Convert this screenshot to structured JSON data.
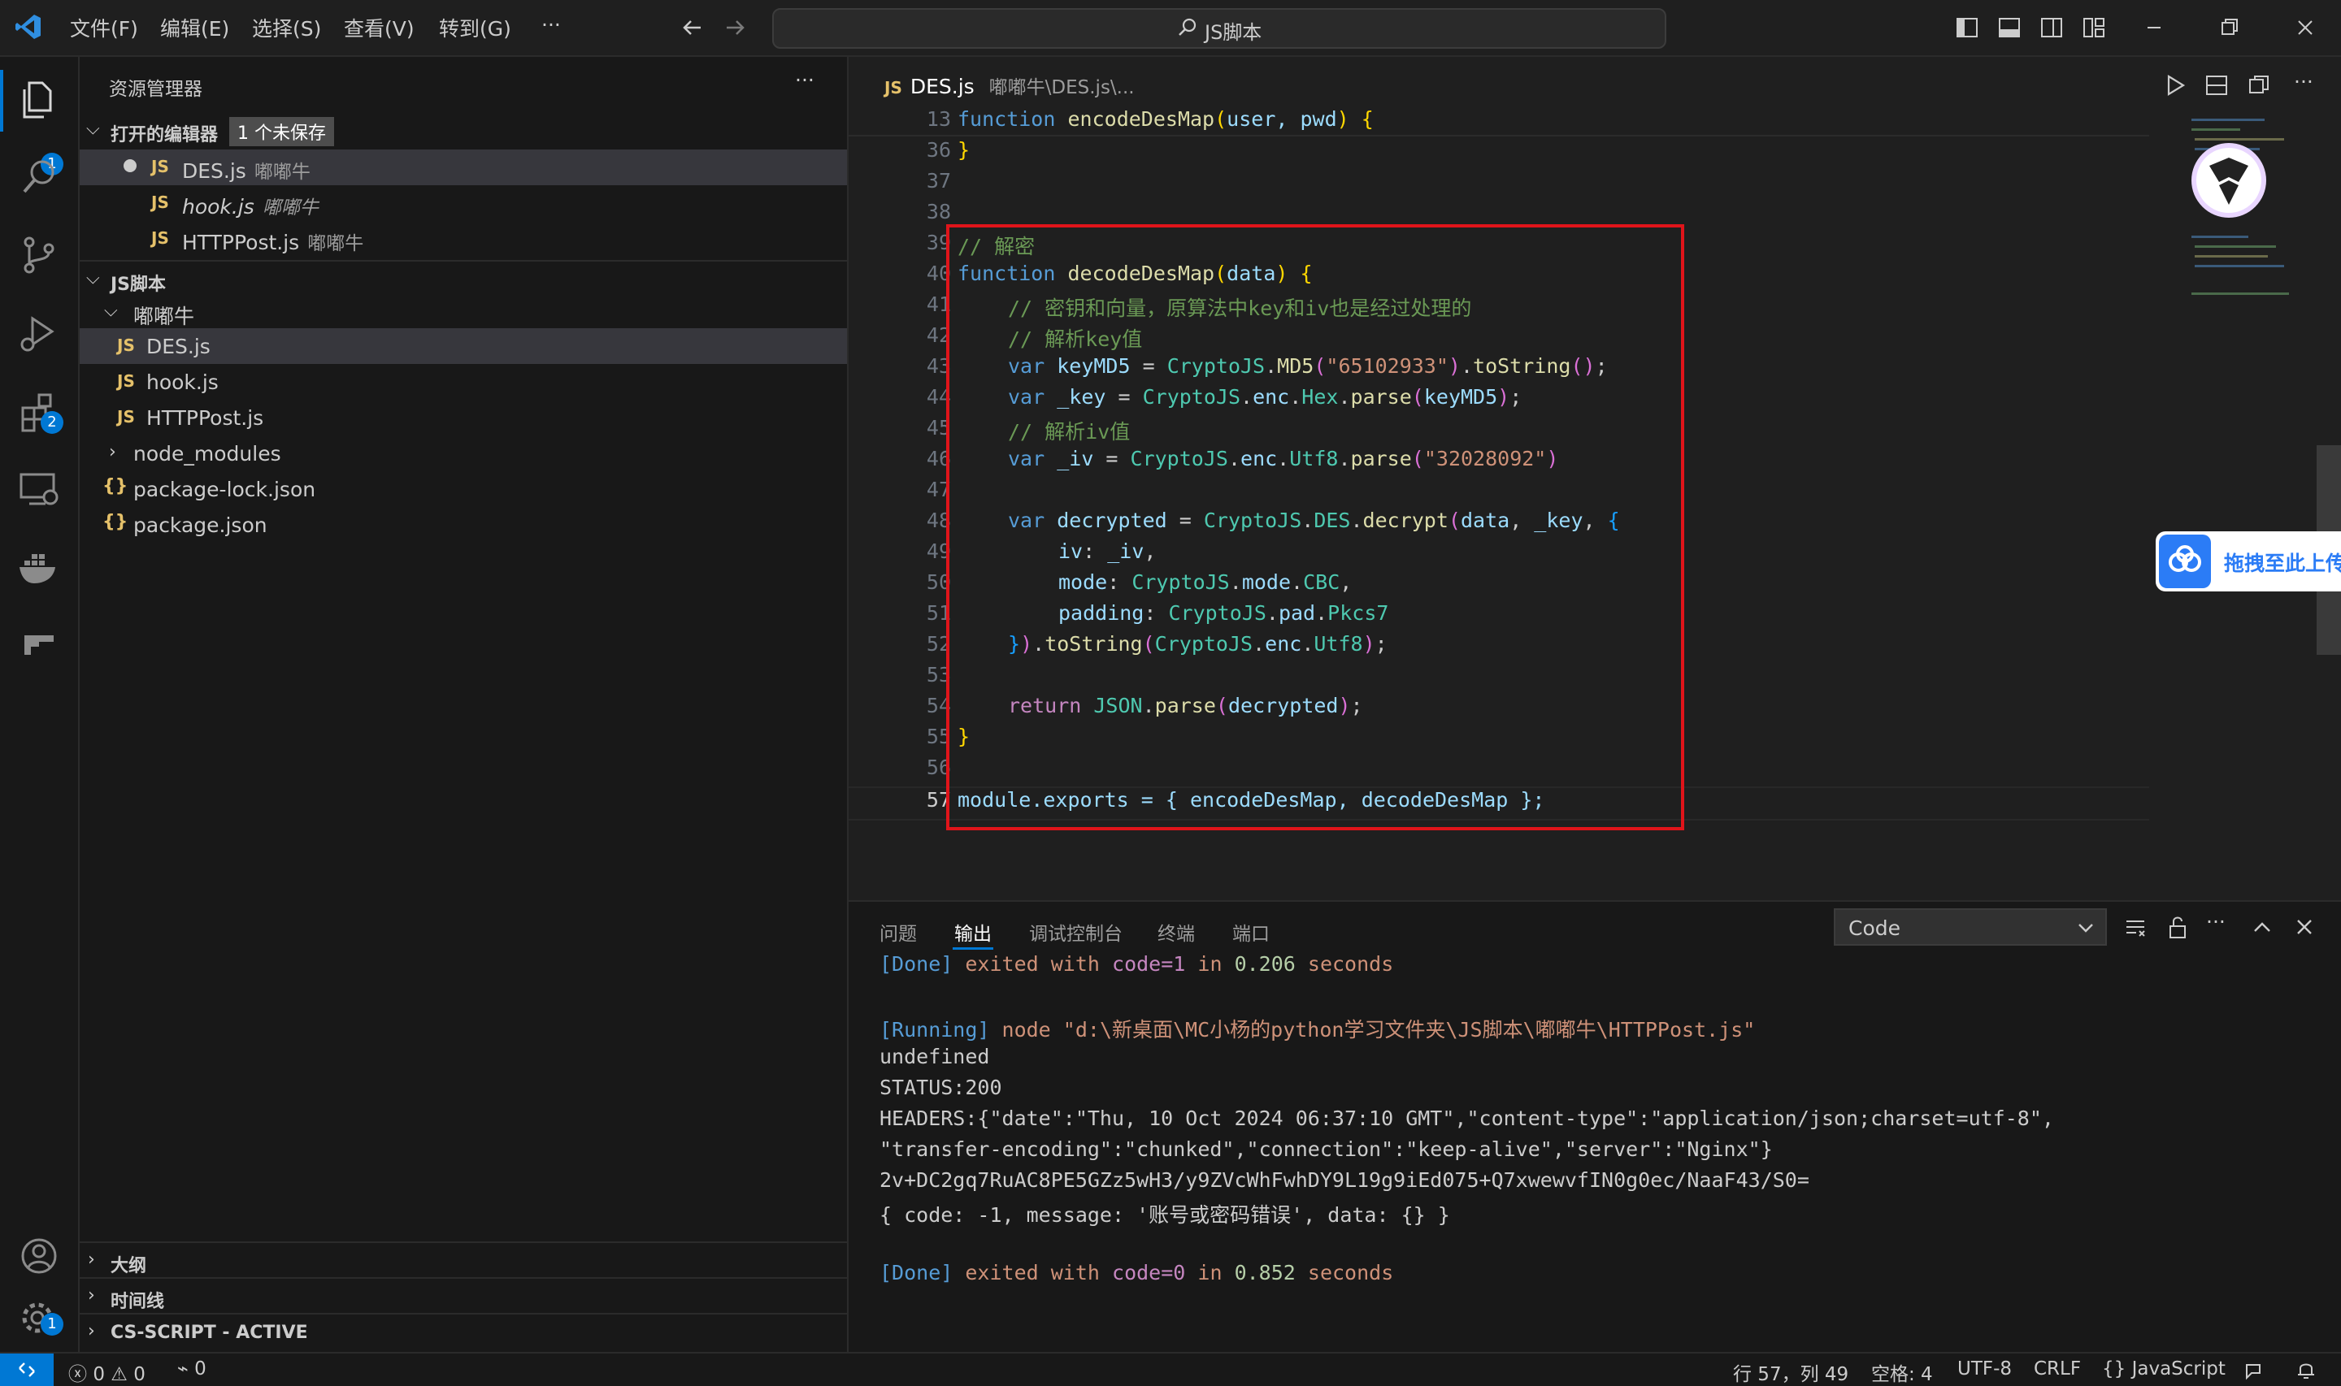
{
  "titlebar": {
    "menus": [
      "文件(F)",
      "编辑(E)",
      "选择(S)",
      "查看(V)",
      "转到(G)",
      "···"
    ],
    "search_text": "JS脚本"
  },
  "activity": {
    "explorer_badge": "1",
    "extensions_badge": "2",
    "settings_badge": "1"
  },
  "sidebar": {
    "title": "资源管理器",
    "more": "···",
    "open_editors": {
      "header": "打开的编辑器",
      "unsaved_badge": "1 个未保存"
    },
    "open_files": [
      {
        "name": "DES.js",
        "desc": "嘟嘟牛"
      },
      {
        "name": "hook.js",
        "desc": "嘟嘟牛"
      },
      {
        "name": "HTTPPost.js",
        "desc": "嘟嘟牛"
      }
    ],
    "workspace": "JS脚本",
    "folder": "嘟嘟牛",
    "folder_files": [
      "DES.js",
      "hook.js",
      "HTTPPost.js"
    ],
    "node_modules": "node_modules",
    "json_files": [
      "package-lock.json",
      "package.json"
    ],
    "outline": "大纲",
    "timeline": "时间线",
    "cs_script": "CS-SCRIPT - ACTIVE"
  },
  "editor": {
    "tab_name": "DES.js",
    "tab_path": "嘟嘟牛\\DES.js\\...",
    "line_numbers": [
      "13",
      "36",
      "37",
      "38",
      "39",
      "40",
      "41",
      "42",
      "43",
      "44",
      "45",
      "46",
      "47",
      "48",
      "49",
      "50",
      "51",
      "52",
      "53",
      "54",
      "55",
      "56",
      "57"
    ],
    "code": {
      "l13_kw": "function",
      "l13_fn": "encodeDesMap",
      "l13_params": "user, pwd",
      "l39": "// 解密",
      "l40_fn": "decodeDesMap",
      "l40_param": "data",
      "l41": "// 密钥和向量，原算法中key和iv也是经过处理的",
      "l42": "// 解析key值",
      "l43_var": "keyMD5",
      "l43_str": "\"65102933\"",
      "l44_var": "_key",
      "l45": "// 解析iv值",
      "l46_var": "_iv",
      "l46_str": "\"32028092\"",
      "l48_var": "decrypted",
      "l57": "module.exports = { encodeDesMap, decodeDesMap };"
    }
  },
  "panel": {
    "tabs": [
      "问题",
      "输出",
      "调试控制台",
      "终端",
      "端口"
    ],
    "active_tab": "输出",
    "channel": "Code",
    "output": {
      "done1_tag": "[Done]",
      "done1_a": "exited with",
      "done1_code": "code=1",
      "done1_b": "in",
      "done1_time": "0.206",
      "done1_c": "seconds",
      "running_tag": "[Running]",
      "running_cmd": "node \"d:\\新桌面\\MC小杨的python学习文件夹\\JS脚本\\嘟嘟牛\\HTTPPost.js\"",
      "undefined": "undefined",
      "status": "STATUS:200",
      "headers1": "HEADERS:{\"date\":\"Thu, 10 Oct 2024 06:37:10 GMT\",\"content-type\":\"application/json;charset=utf-8\",",
      "headers2": "\"transfer-encoding\":\"chunked\",\"connection\":\"keep-alive\",\"server\":\"Nginx\"}",
      "cipher": "2v+DC2gq7RuAC8PE5GZz5wH3/y9ZVcWhFwhDY9L19g9iEd075+Q7xwewvfIN0g0ec/NaaF43/S0=",
      "result": "{ code: -1, message: '账号或密码错误', data: {} }",
      "done2_tag": "[Done]",
      "done2_a": "exited with",
      "done2_code": "code=0",
      "done2_b": "in",
      "done2_time": "0.852",
      "done2_c": "seconds"
    }
  },
  "floating": {
    "upload_text": "拖拽至此上传"
  },
  "statusbar": {
    "errors": "0",
    "warnings": "0",
    "ports": "0",
    "position": "行 57，列 49",
    "spaces": "空格: 4",
    "encoding": "UTF-8",
    "eol": "CRLF",
    "language": "JavaScript"
  },
  "colors": {
    "accent": "#0078d4",
    "highlight_box": "#e0141a",
    "editor_bg": "#1f1f1f",
    "sidebar_bg": "#181818"
  }
}
